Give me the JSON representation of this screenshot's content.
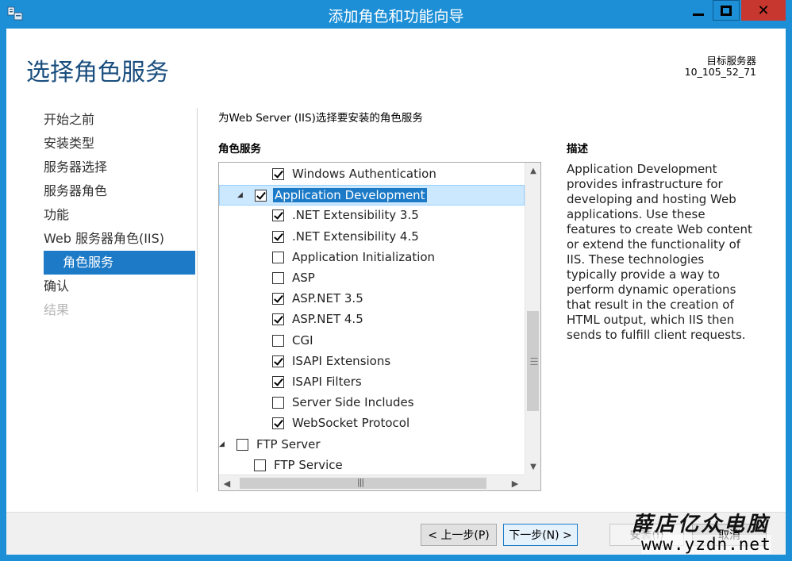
{
  "window": {
    "title": "添加角色和功能向导",
    "icon": "server-manager-icon"
  },
  "header": {
    "page_title": "选择角色服务",
    "target_label": "目标服务器",
    "target_value": "10_105_52_71"
  },
  "nav": {
    "items": [
      {
        "label": "开始之前",
        "state": "normal"
      },
      {
        "label": "安装类型",
        "state": "normal"
      },
      {
        "label": "服务器选择",
        "state": "normal"
      },
      {
        "label": "服务器角色",
        "state": "normal"
      },
      {
        "label": "功能",
        "state": "normal"
      },
      {
        "label": "Web 服务器角色(IIS)",
        "state": "normal"
      },
      {
        "label": "角色服务",
        "state": "active"
      },
      {
        "label": "确认",
        "state": "normal"
      },
      {
        "label": "结果",
        "state": "disabled"
      }
    ]
  },
  "main": {
    "instruction": "为Web Server (IIS)选择要安装的角色服务",
    "role_services_title": "角色服务",
    "description_title": "描述",
    "description": "Application Development provides infrastructure for developing and hosting Web applications. Use these features to create Web content or extend the functionality of IIS. These technologies typically provide a way to perform dynamic operations that result in the creation of HTML output, which IIS then sends to fulfill client requests."
  },
  "tree": {
    "items": [
      {
        "label": "Windows Authentication",
        "checked": true,
        "level": 2,
        "expander": ""
      },
      {
        "label": "Application Development",
        "checked": true,
        "level": 1,
        "expander": "◢",
        "selected": true
      },
      {
        "label": ".NET Extensibility 3.5",
        "checked": true,
        "level": 2,
        "expander": ""
      },
      {
        "label": ".NET Extensibility 4.5",
        "checked": true,
        "level": 2,
        "expander": ""
      },
      {
        "label": "Application Initialization",
        "checked": false,
        "level": 2,
        "expander": ""
      },
      {
        "label": "ASP",
        "checked": false,
        "level": 2,
        "expander": ""
      },
      {
        "label": "ASP.NET 3.5",
        "checked": true,
        "level": 2,
        "expander": ""
      },
      {
        "label": "ASP.NET 4.5",
        "checked": true,
        "level": 2,
        "expander": ""
      },
      {
        "label": "CGI",
        "checked": false,
        "level": 2,
        "expander": ""
      },
      {
        "label": "ISAPI Extensions",
        "checked": true,
        "level": 2,
        "expander": ""
      },
      {
        "label": "ISAPI Filters",
        "checked": true,
        "level": 2,
        "expander": ""
      },
      {
        "label": "Server Side Includes",
        "checked": false,
        "level": 2,
        "expander": ""
      },
      {
        "label": "WebSocket Protocol",
        "checked": true,
        "level": 2,
        "expander": ""
      },
      {
        "label": "FTP Server",
        "checked": false,
        "level": 0,
        "expander": "◢"
      },
      {
        "label": "FTP Service",
        "checked": false,
        "level": 1,
        "expander": ""
      }
    ]
  },
  "buttons": {
    "prev": "< 上一步(P)",
    "next": "下一步(N) >",
    "install": "安装(I)",
    "cancel": "取消"
  },
  "watermark": {
    "line1": "薛店亿众电脑",
    "line2": "www.yzdn.net"
  },
  "icons": {
    "minimize": "minimize-icon",
    "maximize": "maximize-icon",
    "close": "close-icon",
    "scroll_up": "chevron-up-icon",
    "scroll_down": "chevron-down-icon",
    "scroll_left": "chevron-left-icon",
    "scroll_right": "chevron-right-icon"
  },
  "colors": {
    "accent": "#1c8fd6",
    "selection": "#1c7ac7",
    "title_text": "#1a4e7e",
    "close_button": "#c7372f"
  }
}
